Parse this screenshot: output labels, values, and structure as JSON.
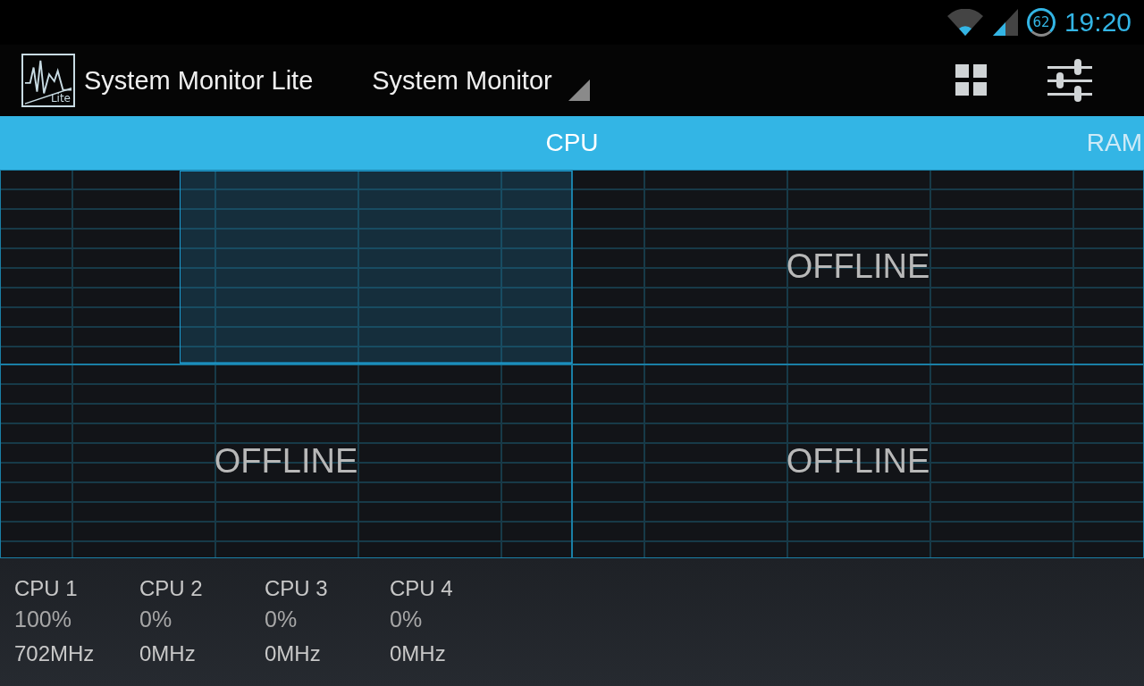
{
  "status_bar": {
    "battery": "62",
    "time": "19:20"
  },
  "action_bar": {
    "logo_label": "Lite",
    "app_title": "System Monitor Lite",
    "spinner": "System Monitor"
  },
  "tabs": [
    {
      "label": "CPU",
      "selected": true
    },
    {
      "label": "RAM",
      "selected": false
    }
  ],
  "graphs": [
    {
      "kind": "activity"
    },
    {
      "kind": "offline",
      "label": "OFFLINE"
    },
    {
      "kind": "offline",
      "label": "OFFLINE"
    },
    {
      "kind": "offline",
      "label": "OFFLINE"
    }
  ],
  "cpus": [
    {
      "name": "CPU 1",
      "load": "100%",
      "frequency": "702MHz"
    },
    {
      "name": "CPU 2",
      "load": "0%",
      "frequency": "0MHz"
    },
    {
      "name": "CPU 3",
      "load": "0%",
      "frequency": "0MHz"
    },
    {
      "name": "CPU 4",
      "load": "0%",
      "frequency": "0MHz"
    }
  ]
}
